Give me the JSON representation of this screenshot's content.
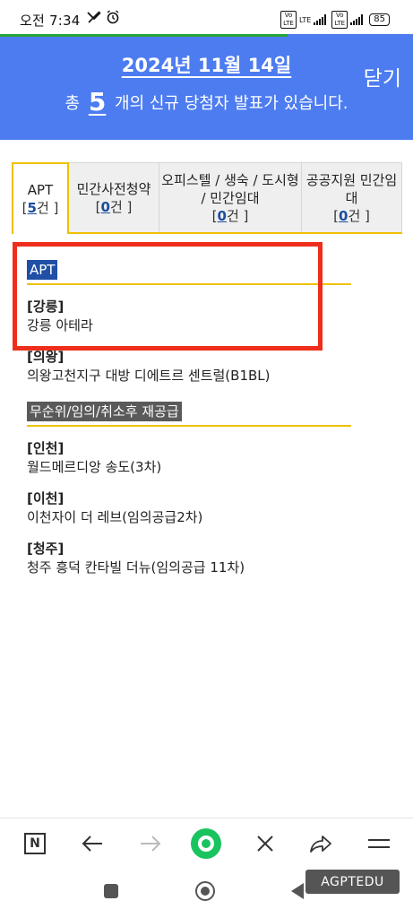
{
  "status_bar": {
    "time": "오전 7:34",
    "icons": [
      "missed-call-icon",
      "alarm-icon"
    ],
    "network_labels": [
      "Vo LTE",
      "LTE",
      "Vo LTE"
    ],
    "battery": "85"
  },
  "header": {
    "date": "2024년 11월 14일",
    "close_label": "닫기",
    "notice_prefix": "총",
    "notice_count": "5",
    "notice_suffix": "개의 신규 당첨자 발표가 있습니다."
  },
  "tabs": [
    {
      "label": "APT",
      "count_open": "[",
      "count": "5",
      "count_close": "건 ]",
      "active": true
    },
    {
      "label": "민간사전청약",
      "count_open": "[",
      "count": "0",
      "count_close": "건 ]",
      "active": false
    },
    {
      "label": "오피스텔 / 생숙 / 도시형 / 민간임대",
      "count_open": "[",
      "count": "0",
      "count_close": "건 ]",
      "active": false
    },
    {
      "label": "공공지원 민간임대",
      "count_open": "[",
      "count": "0",
      "count_close": "건 ]",
      "active": false
    }
  ],
  "sections": [
    {
      "label": "APT",
      "items": [
        {
          "region": "[강릉]",
          "name": "강릉 아테라"
        },
        {
          "region": "[의왕]",
          "name": "의왕고천지구 대방 디에트르 센트럴(B1BL)"
        }
      ]
    },
    {
      "label": "무순위/임의/취소후 재공급",
      "items": [
        {
          "region": "[인천]",
          "name": "월드메르디앙 송도(3차)"
        },
        {
          "region": "[이천]",
          "name": "이천자이 더 레브(임의공급2차)"
        },
        {
          "region": "[청주]",
          "name": "청주 흥덕 칸타빌 더뉴(임의공급 11차)"
        }
      ]
    }
  ],
  "toolbar": {
    "icons": [
      "naver-n-icon",
      "back-arrow-icon",
      "forward-arrow-icon",
      "green-home-icon",
      "close-x-icon",
      "share-icon",
      "menu-icon"
    ],
    "n_label": "N"
  },
  "watermark": "AGPTEDU",
  "colors": {
    "header_bg": "#4d7cf0",
    "accent_yellow": "#f0c000",
    "highlight_red": "#ee2e1a",
    "label_blue": "#1f4fa6",
    "green": "#19c45f"
  }
}
